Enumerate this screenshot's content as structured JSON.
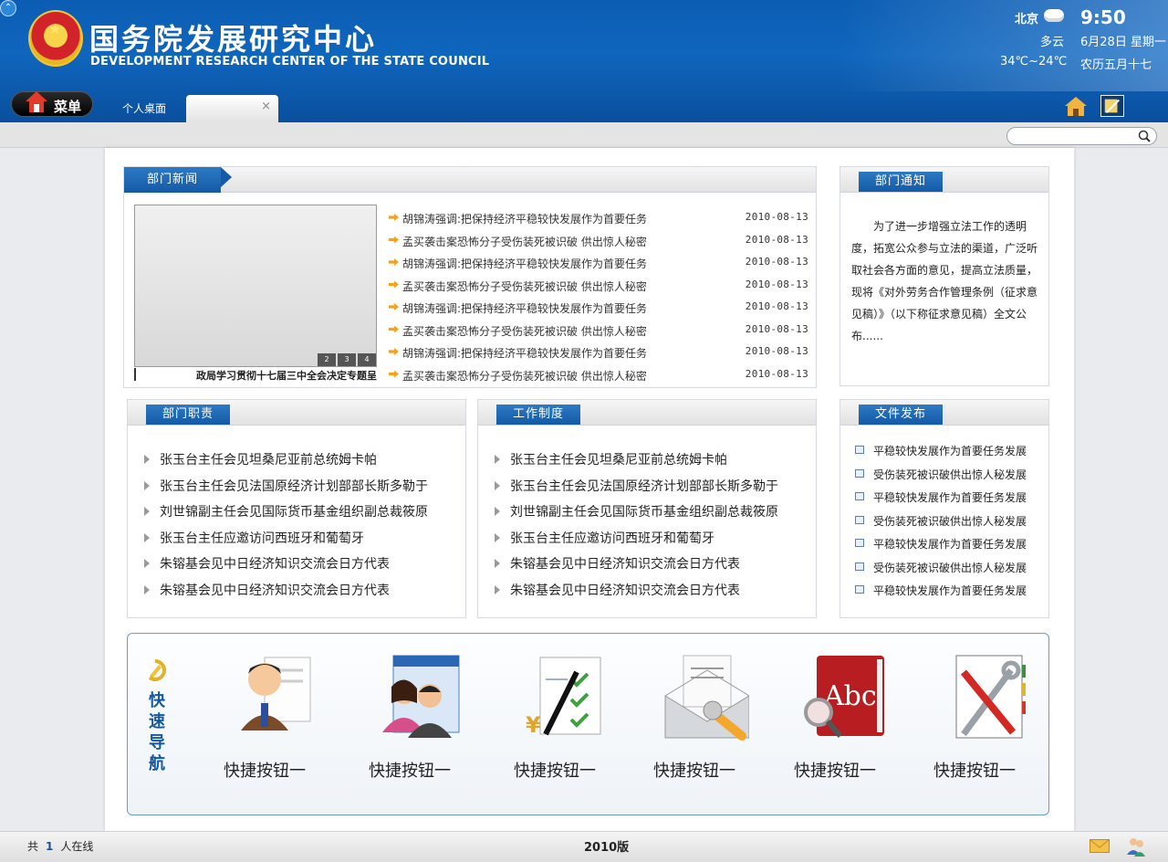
{
  "header": {
    "title_cn": "国务院发展研究中心",
    "title_en": "DEVELOPMENT RESEARCH CENTER OF THE STATE COUNCIL"
  },
  "weather": {
    "city": "北京",
    "time": "9:50",
    "condition": "多云",
    "date": "6月28日 星期一",
    "temp": "34℃~24℃",
    "lunar": "农历五月十七"
  },
  "nav": {
    "menu_label": "菜单",
    "tab_desktop": "个人桌面",
    "tab_close": "×"
  },
  "news": {
    "title": "部门新闻",
    "caption": "政局学习贯彻十七届三中全会决定专题呈",
    "pager": [
      "2",
      "3",
      "4"
    ],
    "items": [
      {
        "title": "胡锦涛强调:把保持经济平稳较快发展作为首要任务",
        "date": "2010-08-13"
      },
      {
        "title": "孟买袭击案恐怖分子受伤装死被识破 供出惊人秘密",
        "date": "2010-08-13"
      },
      {
        "title": "胡锦涛强调:把保持经济平稳较快发展作为首要任务",
        "date": "2010-08-13"
      },
      {
        "title": "孟买袭击案恐怖分子受伤装死被识破 供出惊人秘密",
        "date": "2010-08-13"
      },
      {
        "title": "胡锦涛强调:把保持经济平稳较快发展作为首要任务",
        "date": "2010-08-13"
      },
      {
        "title": "孟买袭击案恐怖分子受伤装死被识破 供出惊人秘密",
        "date": "2010-08-13"
      },
      {
        "title": "胡锦涛强调:把保持经济平稳较快发展作为首要任务",
        "date": "2010-08-13"
      },
      {
        "title": "孟买袭击案恐怖分子受伤装死被识破 供出惊人秘密",
        "date": "2010-08-13"
      }
    ]
  },
  "notice": {
    "title": "部门通知",
    "body": "为了进一步增强立法工作的透明度，拓宽公众参与立法的渠道，广泛听取社会各方面的意见，提高立法质量，现将《对外劳务合作管理条例（征求意见稿）》（以下称征求意见稿）全文公布......"
  },
  "duties": {
    "title": "部门职责",
    "items": [
      "张玉台主任会见坦桑尼亚前总统姆卡帕",
      "张玉台主任会见法国原经济计划部部长斯多勒于",
      "刘世锦副主任会见国际货币基金组织副总裁筱原",
      "张玉台主任应邀访问西班牙和葡萄牙",
      "朱镕基会见中日经济知识交流会日方代表",
      "朱镕基会见中日经济知识交流会日方代表"
    ]
  },
  "system": {
    "title": "工作制度",
    "items": [
      "张玉台主任会见坦桑尼亚前总统姆卡帕",
      "张玉台主任会见法国原经济计划部部长斯多勒于",
      "刘世锦副主任会见国际货币基金组织副总裁筱原",
      "张玉台主任应邀访问西班牙和葡萄牙",
      "朱镕基会见中日经济知识交流会日方代表",
      "朱镕基会见中日经济知识交流会日方代表"
    ]
  },
  "files": {
    "title": "文件发布",
    "items": [
      "平稳较快发展作为首要任务发展",
      "受伤装死被识破供出惊人秘发展",
      "平稳较快发展作为首要任务发展",
      "受伤装死被识破供出惊人秘发展",
      "平稳较快发展作为首要任务发展",
      "受伤装死被识破供出惊人秘发展",
      "平稳较快发展作为首要任务发展"
    ]
  },
  "quick": {
    "label": "快速导航",
    "buttons": [
      {
        "label": "快捷按钮一",
        "icon": "user-document-icon"
      },
      {
        "label": "快捷按钮一",
        "icon": "mail-contacts-icon"
      },
      {
        "label": "快捷按钮一",
        "icon": "finance-checklist-icon"
      },
      {
        "label": "快捷按钮一",
        "icon": "mail-settings-icon"
      },
      {
        "label": "快捷按钮一",
        "icon": "dictionary-icon"
      },
      {
        "label": "快捷按钮一",
        "icon": "tools-notebook-icon"
      }
    ]
  },
  "footer": {
    "online_prefix": "共",
    "online_count": "1",
    "online_suffix": "人在线",
    "version": "2010版"
  },
  "colors": {
    "header_blue": "#0f66bd",
    "panel_tab_blue": "#1f6bb8",
    "news_bullet": "#f5a21b"
  }
}
